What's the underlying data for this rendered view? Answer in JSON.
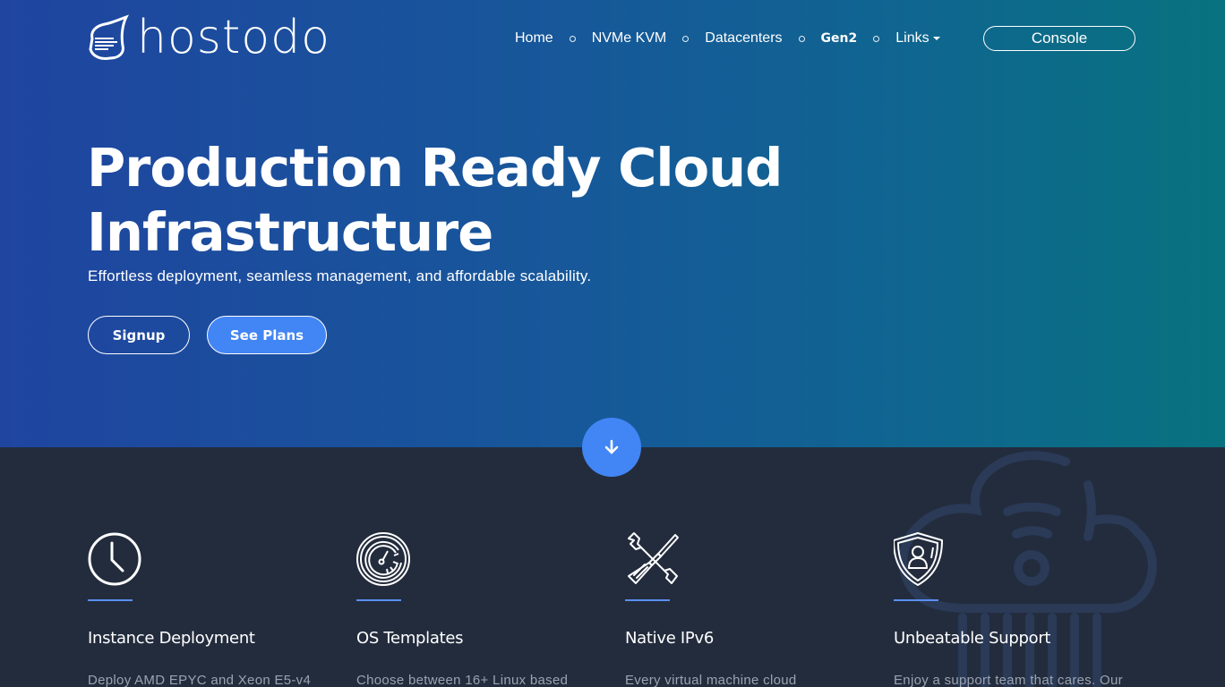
{
  "brand": {
    "name": "hostodo",
    "logo_icon": "hostodo-logo-icon"
  },
  "nav": {
    "items": [
      {
        "label": "Home",
        "bold": false
      },
      {
        "label": "NVMe KVM",
        "bold": false
      },
      {
        "label": "Datacenters",
        "bold": false
      },
      {
        "label": "Gen2",
        "bold": true
      },
      {
        "label": "Links",
        "bold": false,
        "dropdown": true
      }
    ],
    "console_label": "Console"
  },
  "hero": {
    "title_line1": "Production Ready Cloud",
    "title_line2": "Infrastructure",
    "subtitle": "Effortless deployment, seamless management, and affordable scalability.",
    "signup_label": "Signup",
    "plans_label": "See Plans",
    "scroll_icon": "arrow-down-icon"
  },
  "colors": {
    "accent": "#4285f4",
    "hero_gradient_start": "#1f45a0",
    "hero_gradient_end": "#08727f",
    "section_bg": "#232c3d",
    "rule": "#5b8ff0",
    "muted_text": "#9aa3b1"
  },
  "features": [
    {
      "icon": "clock-icon",
      "title": "Instance Deployment",
      "desc": "Deploy AMD EPYC and Xeon E5-v4"
    },
    {
      "icon": "speedometer-icon",
      "title": "OS Templates",
      "desc": "Choose between 16+ Linux based"
    },
    {
      "icon": "tools-icon",
      "title": "Native IPv6",
      "desc": "Every virtual machine cloud"
    },
    {
      "icon": "shield-user-icon",
      "title": "Unbeatable Support",
      "desc": "Enjoy a support team that cares. Our"
    }
  ]
}
